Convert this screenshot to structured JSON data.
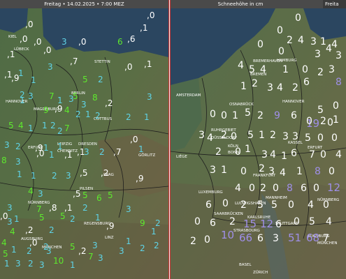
{
  "left_panel": {
    "header": "Freitag • 14.02.2025 • 7:00 MEZ",
    "cities": [
      "KIEL",
      "LÜBECK",
      "STETTIN",
      "HANNOVER",
      "BERLIN",
      "MAGDEBURG",
      "COTTBUS",
      "DRESDEN",
      "ERFURT",
      "LEIPZIG",
      "CHEMNITZ",
      "PILSEN",
      "PRAG",
      "NÜRNBERG",
      "LINZ",
      "REGENSBURG",
      "AUGSBURG",
      "MÜNCHEN",
      "GÖRLITZ"
    ],
    "values": [
      ",0",
      ",0",
      ",1",
      ",0",
      ",0",
      "3",
      ",0",
      "6",
      ",6",
      ",0",
      ",1",
      ",7",
      "3",
      ",0",
      ",1",
      ",1",
      ",9",
      "1",
      "1",
      "5",
      "2",
      "3",
      "2",
      "1",
      "3",
      "7",
      "1",
      "3",
      "5",
      "3",
      "8",
      ",2",
      "9",
      ",9",
      "4",
      "2",
      "1",
      "2",
      "5",
      "4",
      "1",
      "1",
      "2",
      "2",
      "7",
      "2",
      "1",
      "3",
      "2",
      ",9",
      "1",
      "1",
      ",1",
      ",0",
      "8",
      "3",
      ",0",
      "1",
      ",1",
      "3",
      "2",
      ",7",
      "1",
      "1",
      "1",
      "2",
      "3",
      ",5",
      ",2",
      ",9",
      "4",
      "3",
      ",5",
      "5",
      "6",
      "5",
      "3",
      "7",
      ",8",
      ",1",
      "2",
      "3",
      ",0",
      "3",
      "1",
      "5",
      "5",
      "2",
      "1",
      "4",
      ",2",
      "2",
      ",9",
      "9",
      "2",
      "4",
      ",0",
      "2",
      "5",
      "3",
      "1",
      "1",
      "5",
      "1",
      "2",
      "3",
      ",2",
      "3",
      "2",
      "2",
      "1",
      "3",
      "2",
      "3",
      "10",
      "1",
      "7",
      "3"
    ],
    "colors": {
      "trace": "#ffffff",
      "light": "#5fd3e6",
      "medium": "#5ee82e"
    }
  },
  "right_panel": {
    "header": "Schneehöhe in cm",
    "header_extra": "Freita",
    "cities": [
      "AMSTERDAM",
      "BREMERHAVEN",
      "HAMBURG",
      "BREMEN",
      "HANNOVER",
      "OSNABRÜCK",
      "RUHRGEBIET",
      "DÜSSELDORF",
      "KÖLN",
      "BONN",
      "LIÈGE",
      "KASSEL",
      "ERFURT",
      "FRANKFURT",
      "LUXEMBURG",
      "MANNHEIM",
      "KARLSRUHE",
      "STUTTGART",
      "SAARBRÜCKEN",
      "NÜRNBERG",
      "STRASBOURG",
      "AUGSBURG",
      "MÜNCHEN",
      "BASEL",
      "ZÜRICH",
      "LUDWIGSHAFEN"
    ],
    "values": [
      "0",
      "0",
      "2",
      "4",
      "3",
      "1",
      "4",
      "0",
      "0",
      "3",
      "4",
      "3",
      "4",
      "5",
      "4",
      "1",
      "0",
      "2",
      "3",
      "1",
      "2",
      "3",
      "4",
      "2",
      "6",
      "8",
      "5",
      "19",
      "0",
      "0",
      "0",
      "0",
      "1",
      "5",
      "2",
      "9",
      "6",
      "0",
      "2",
      "1",
      "3",
      "4",
      "2",
      "0",
      "5",
      "1",
      "2",
      "3",
      "3",
      "5",
      "0",
      "0",
      "2",
      "0",
      "1",
      "3",
      "4",
      "1",
      "6",
      "7",
      "0",
      "4",
      "3",
      "1",
      "0",
      "2",
      "3",
      "4",
      "1",
      "8",
      "0",
      "4",
      "0",
      "2",
      "0",
      "8",
      "6",
      "0",
      "12",
      "6",
      "0",
      "2",
      "5",
      "5",
      "0",
      "4",
      "0",
      "0",
      "6",
      "2",
      "15",
      "12",
      "6",
      "0",
      "5",
      "4",
      "2",
      "0",
      "10",
      "66",
      "6",
      "3",
      "51",
      "68",
      "7"
    ],
    "colors": {
      "low": "#ffffff",
      "high": "#9f8fe8"
    }
  }
}
